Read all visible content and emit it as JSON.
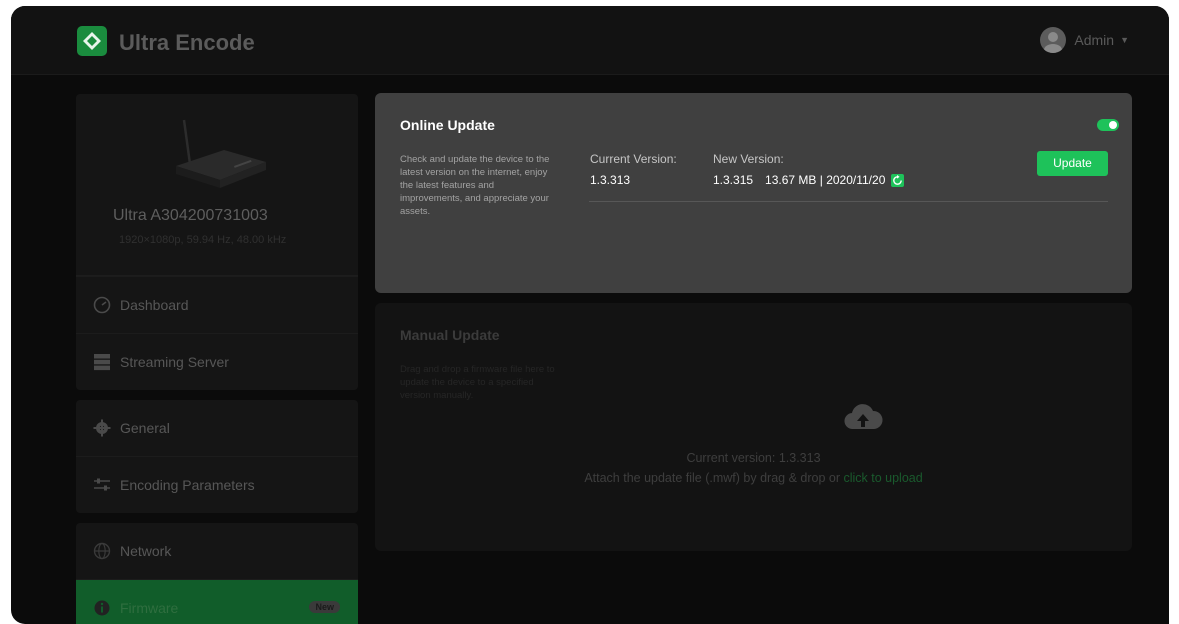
{
  "header": {
    "app_title": "Ultra Encode",
    "user_name": "Admin"
  },
  "device": {
    "name": "Ultra A304200731003",
    "signal": "1920×1080p, 59.94 Hz, 48.00 kHz"
  },
  "sidebar": {
    "groups": [
      [
        {
          "label": "Dashboard",
          "icon": "dashboard-icon"
        },
        {
          "label": "Streaming Server",
          "icon": "server-icon"
        }
      ],
      [
        {
          "label": "General",
          "icon": "gear-icon"
        },
        {
          "label": "Encoding Parameters",
          "icon": "sliders-icon"
        }
      ],
      [
        {
          "label": "Network",
          "icon": "globe-icon"
        },
        {
          "label": "Firmware",
          "icon": "info-icon",
          "badge": "New",
          "active": true
        }
      ]
    ]
  },
  "online_update": {
    "title": "Online Update",
    "enabled": true,
    "description": "Check and update the device to the latest version on the internet, enjoy the latest features and improvements, and appreciate your assets.",
    "current_version_label": "Current Version:",
    "current_version": "1.3.313",
    "new_version_label": "New Version:",
    "new_version": "1.3.315",
    "new_version_meta": "13.67 MB | 2020/11/20",
    "update_button": "Update"
  },
  "manual_update": {
    "title": "Manual Update",
    "description": "Drag and drop a firmware file here to update the device to a specified version manually.",
    "current_version_text": "Current version: 1.3.313",
    "attach_text": "Attach the update file (.mwf) by drag & drop or ",
    "upload_link": "click to upload"
  },
  "colors": {
    "accent": "#1ec25a",
    "background": "#0b0b0b",
    "card_active": "#404040"
  }
}
